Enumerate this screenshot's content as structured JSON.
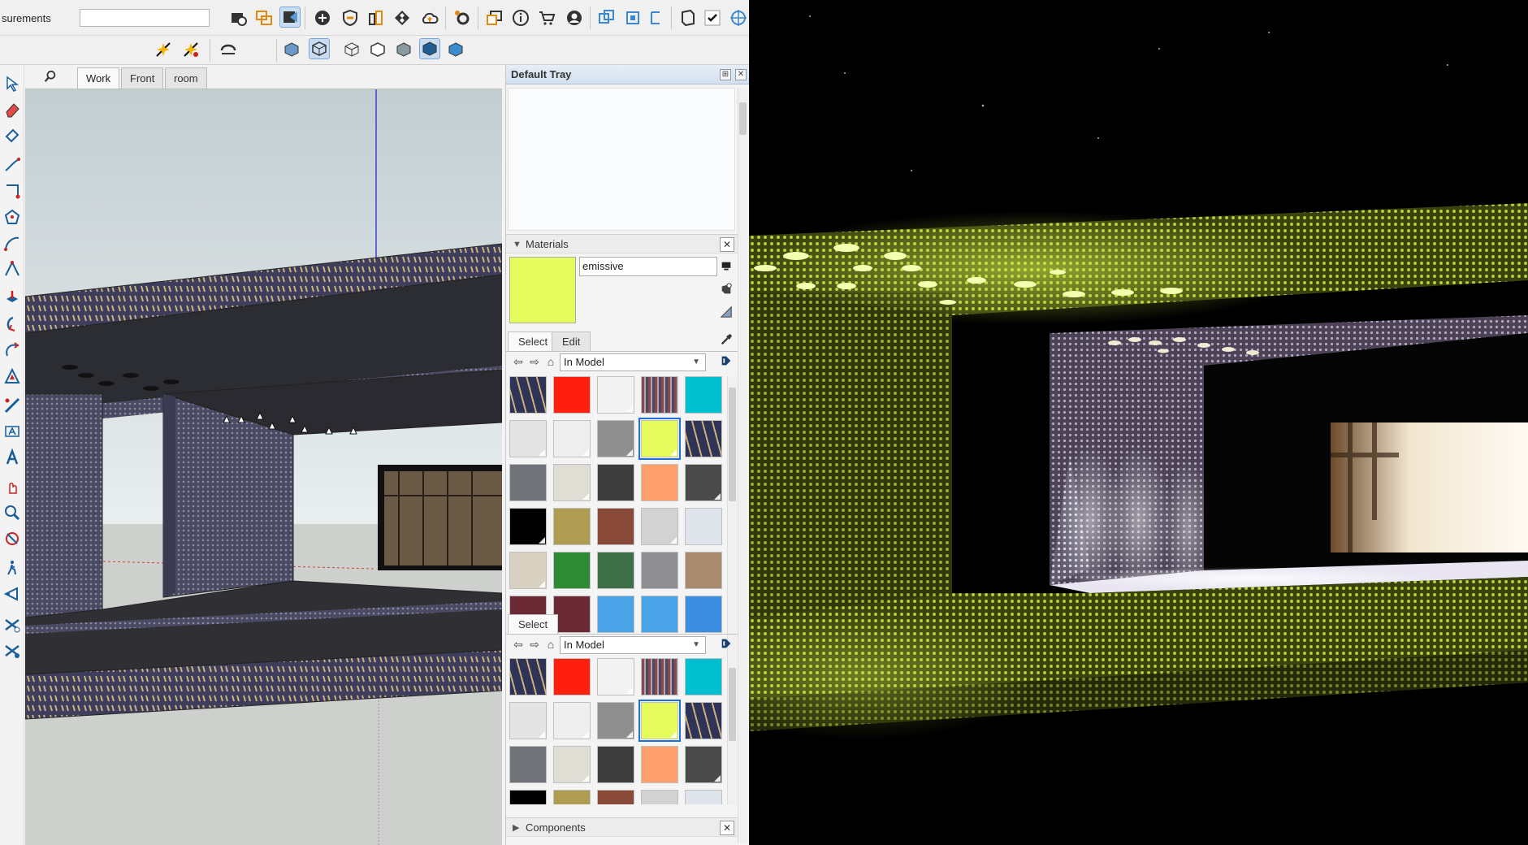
{
  "toolbar": {
    "measurements_label": "surements",
    "measurements_value": ""
  },
  "scene_tabs": [
    {
      "label": "Work"
    },
    {
      "label": "Front"
    },
    {
      "label": "room"
    }
  ],
  "tray": {
    "title": "Default Tray",
    "materials_section": "Materials",
    "material_name": "emissive",
    "tab_select": "Select",
    "tab_edit": "Edit",
    "collection": "In Model",
    "collection_2": "In Model",
    "tab_select_2": "Select",
    "components_section": "Components"
  },
  "colors": {
    "selected_material": "#e6fb5c",
    "accent": "#1e6fd6"
  },
  "swatches": [
    "pattern-navy",
    "#ff1f0e",
    "#f2f2f2",
    "pattern-stripe",
    "#00bfcf",
    "#e4e4e4",
    "#efefef",
    "#8f8f8f",
    "#e6fb5c",
    "pattern-navy",
    "#6f7378",
    "#e0ddd4",
    "#3d3d3d",
    "#ffa06c",
    "#4a4a4a",
    "#000000",
    "#b09c52",
    "#8a4a3a",
    "#d2d2d2",
    "#dfe3ea",
    "#d8d0c0",
    "#2f8a36",
    "#3f6f48",
    "#8e8e93",
    "#a88a6e",
    "#6b2b36",
    "#6b2b36",
    "#4aa3e6",
    "#4aa3e6",
    "#3d8de0"
  ],
  "swatches_2": [
    "pattern-navy",
    "#ff1f0e",
    "#f2f2f2",
    "pattern-stripe",
    "#00bfcf",
    "#e4e4e4",
    "#efefef",
    "#8f8f8f",
    "#e6fb5c",
    "pattern-navy",
    "#6f7378",
    "#e0ddd4",
    "#3d3d3d",
    "#ffa06c",
    "#4a4a4a",
    "#000000",
    "#b09c52",
    "#8a4a3a",
    "#d2d2d2",
    "#dfe3ea"
  ],
  "selected_index": 8
}
